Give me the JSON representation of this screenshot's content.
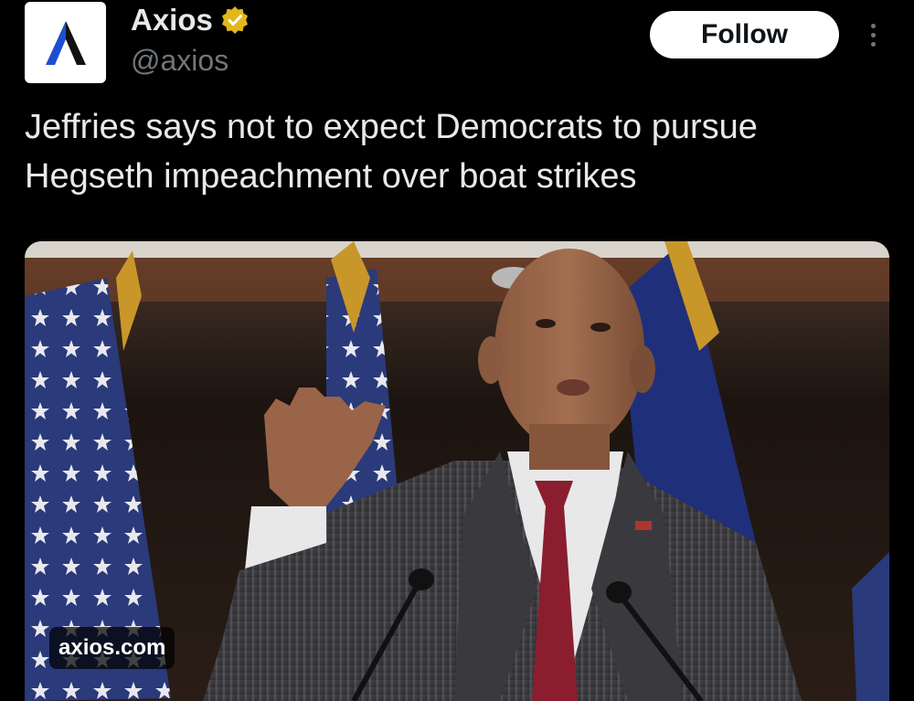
{
  "account": {
    "display_name": "Axios",
    "handle": "@axios",
    "verified_icon": "verified-badge-gold",
    "avatar_icon": "axios-logo",
    "avatar_logo_letter": "A"
  },
  "actions": {
    "follow_label": "Follow",
    "more_icon": "more-vertical-icon"
  },
  "post": {
    "text": "Jeffries says not to expect Democrats to pursue Hegseth impeachment over boat strikes"
  },
  "media": {
    "domain": "axios.com"
  },
  "colors": {
    "background": "#000000",
    "primary_text": "#e7e9ea",
    "secondary_text": "#71767b",
    "follow_bg": "#ffffff",
    "follow_text": "#0f1419",
    "verified_gold": "#e2b719",
    "axios_blue": "#1c4fd1"
  }
}
